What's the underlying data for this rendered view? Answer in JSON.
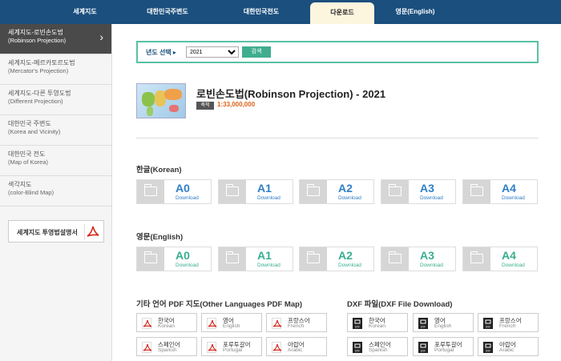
{
  "nav": {
    "tabs": [
      {
        "label": "세계지도"
      },
      {
        "label": "대한민국주변도"
      },
      {
        "label": "대한민국전도"
      },
      {
        "label": "다운로드"
      },
      {
        "label": "영문(English)"
      }
    ]
  },
  "sidebar": {
    "items": [
      {
        "ko": "세계지도-로빈손도법",
        "en": "(Robinson Projection)"
      },
      {
        "ko": "세계지도-메르카토르도법",
        "en": "(Mercator's Projection)"
      },
      {
        "ko": "세계지도-다른 투영도법",
        "en": "(Different Projection)"
      },
      {
        "ko": "대한민국 주변도",
        "en": "(Korea and Vicinity)"
      },
      {
        "ko": "대한민국 전도",
        "en": "(Map of Korea)"
      },
      {
        "ko": "색각지도",
        "en": "(color-Blind Map)"
      }
    ],
    "manual_label": "세계지도 투영법설명서"
  },
  "search": {
    "label": "년도 선택 ▸",
    "selected": "2021",
    "button": "검색"
  },
  "map": {
    "title": "로빈손도법(Robinson Projection) - 2021",
    "scale_tag": "축척",
    "scale_value": "1:33,000,000"
  },
  "korean": {
    "title": "한글(Korean)",
    "buttons": [
      {
        "size": "A0",
        "label": "Download"
      },
      {
        "size": "A1",
        "label": "Download"
      },
      {
        "size": "A2",
        "label": "Download"
      },
      {
        "size": "A3",
        "label": "Download"
      },
      {
        "size": "A4",
        "label": "Download"
      }
    ]
  },
  "english": {
    "title": "영문(English)",
    "buttons": [
      {
        "size": "A0",
        "label": "Download"
      },
      {
        "size": "A1",
        "label": "Download"
      },
      {
        "size": "A2",
        "label": "Download"
      },
      {
        "size": "A3",
        "label": "Download"
      },
      {
        "size": "A4",
        "label": "Download"
      }
    ]
  },
  "other_pdf": {
    "title": "기타 언어 PDF 지도(Other Languages PDF Map)",
    "items": [
      {
        "ko": "한국어",
        "en": "Korean"
      },
      {
        "ko": "영어",
        "en": "English"
      },
      {
        "ko": "프랑스어",
        "en": "French"
      },
      {
        "ko": "스페인어",
        "en": "Spanish"
      },
      {
        "ko": "포루투갈어",
        "en": "Portugal"
      },
      {
        "ko": "아랍어",
        "en": "Arabic"
      }
    ]
  },
  "dxf": {
    "title": "DXF 파일(DXF File Download)",
    "icon_text": "DXF",
    "items": [
      {
        "ko": "한국어",
        "en": "Korean"
      },
      {
        "ko": "영어",
        "en": "English"
      },
      {
        "ko": "프랑스어",
        "en": "French"
      },
      {
        "ko": "스페인어",
        "en": "Spanish"
      },
      {
        "ko": "포루투갈어",
        "en": "Portugal"
      },
      {
        "ko": "아랍어",
        "en": "Arabic"
      }
    ]
  },
  "colors": {
    "nav_bg": "#1b4f7e",
    "active_tab": "#fdf6df",
    "accent_green": "#39ae8f",
    "accent_blue": "#2f7fc6",
    "scale_orange": "#e0621a"
  }
}
